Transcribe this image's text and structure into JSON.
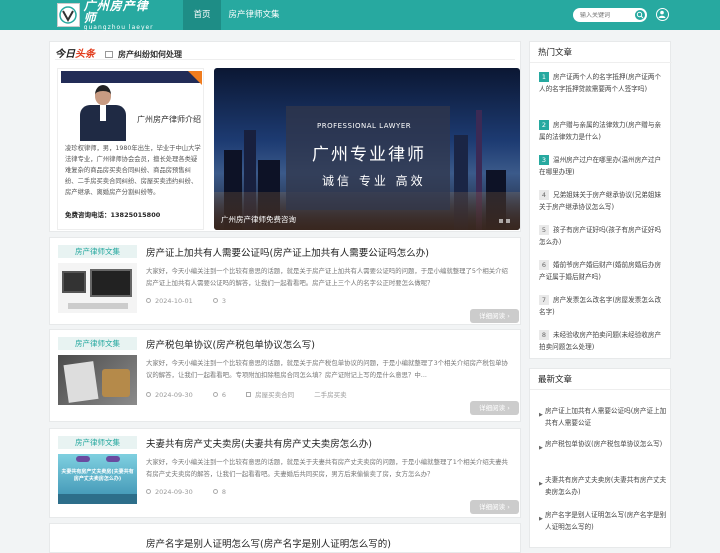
{
  "header": {
    "logo_cn": "广州房产律师",
    "logo_en": "guangzhou laeyer",
    "nav": [
      "首页",
      "房产律师文集"
    ],
    "search_placeholder": "输入关键词"
  },
  "today": {
    "brand_a": "今日",
    "brand_b": "头条",
    "topic": "房产纠纷如何处理"
  },
  "lawyer": {
    "title": "广州房产律师介绍",
    "intro": "凌珍权律师，男，1980年出生，毕业于中山大学法律专业，广州律师协会会员，擅长处理各类疑难复杂的商品房买卖合同纠纷、商品房预售纠纷、二手房买卖合同纠纷、房屋买卖违约纠纷、房产继承、离婚房产分割纠纷等。",
    "tel_label": "免费咨询电话：",
    "tel": "13825015800"
  },
  "banner": {
    "subtitle": "PROFESSIONAL LAWYER",
    "title": "广州专业律师",
    "slogan": "诚信 专业 高效",
    "caption": "广州房产律师免费咨询"
  },
  "articles": [
    {
      "category": "房产律师文集",
      "title": "房产证上加共有人需要公证吗(房产证上加共有人需要公证吗怎么办)",
      "excerpt": "大家好，今天小编关注到一个比较有意思的话题，就是关于房产证上加共有人需要公证吗的问题，于是小编就整理了5个相关介绍房产证上加共有人需要公证吗的解答，让我们一起看看吧。房产证上三个人的名字公正时要怎么做呢？",
      "date": "2024-10-01",
      "views": "3",
      "tags": [],
      "more": "详细阅读 ›"
    },
    {
      "category": "房产律师文集",
      "title": "房产税包单协议(房产税包单协议怎么写)",
      "excerpt": "大家好，今天小编关注到一个比较有意思的话题，就是关于房产税包单协议的问题，于是小编就整理了3个相关介绍房产税包单协议的解答，让我们一起看看吧。专项附加扣除租房合同怎么填？房产证附记上写的是什么意思？中...",
      "date": "2024-09-30",
      "views": "6",
      "tags": [
        "房屋买卖合同",
        "二手房买卖"
      ],
      "more": "详细阅读 ›"
    },
    {
      "category": "房产律师文集",
      "title": "夫妻共有房产丈夫卖房(夫妻共有房产丈夫卖房怎么办)",
      "excerpt": "大家好，今天小编关注到一个比较有意思的话题，就是关于夫妻共有房产丈夫卖房的问题，于是小编就整理了1个相关介绍夫妻共有房产丈夫卖房的解答，让我们一起看看吧。夫妻婚后共同买房，男方后来偷偷卖了房，女方怎么办？",
      "date": "2024-09-30",
      "views": "8",
      "tags": [],
      "more": "详细阅读 ›"
    },
    {
      "category": "房产律师文集",
      "title": "房产名字是别人证明怎么写(房产名字是别人证明怎么写的)",
      "excerpt": "",
      "date": "",
      "views": "",
      "tags": [],
      "more": ""
    }
  ],
  "thumb3_text": "夫妻共有房产丈夫卖房(夫妻共有房产丈夫卖房怎么办)",
  "sidebar": {
    "hot_title": "热门文章",
    "hot": [
      {
        "n": "1",
        "text": "房产证两个人的名字抵押(房产证两个人的名字抵押贷款需要两个人签字吗)"
      },
      {
        "n": "2",
        "text": "房产赠与亲属的法律效力(房产赠与亲属的法律效力是什么)"
      },
      {
        "n": "3",
        "text": "温州房产过户在哪里办(温州房产过户在哪里办理)"
      },
      {
        "n": "4",
        "text": "兄弟姐妹关于房产继承协议(兄弟姐妹关于房产继承协议怎么写)"
      },
      {
        "n": "5",
        "text": "孩子有房产证好吗(孩子有房产证好吗怎么办)"
      },
      {
        "n": "6",
        "text": "婚前爷房产婚后财产(婚前房婚后办房产证属于婚后财产吗)"
      },
      {
        "n": "7",
        "text": "房产发票怎么改名字(房屋发票怎么改名字)"
      },
      {
        "n": "8",
        "text": "未经验收房产拍卖问题(未经验收房产拍卖问题怎么处理)"
      }
    ],
    "new_title": "最新文章",
    "new": [
      {
        "text": "房产证上加共有人需要公证吗(房产证上加共有人需要公证"
      },
      {
        "text": "房产税包单协议(房产税包单协议怎么写)"
      },
      {
        "text": "夫妻共有房产丈夫卖房(夫妻共有房产丈夫卖房怎么办)"
      },
      {
        "text": "房产名字是别人证明怎么写(房产名字是别人证明怎么写的)"
      }
    ]
  },
  "colors": {
    "accent": "#27a9a0",
    "nav_active": "#1e8d86",
    "brand_red": "#e23c1d"
  }
}
